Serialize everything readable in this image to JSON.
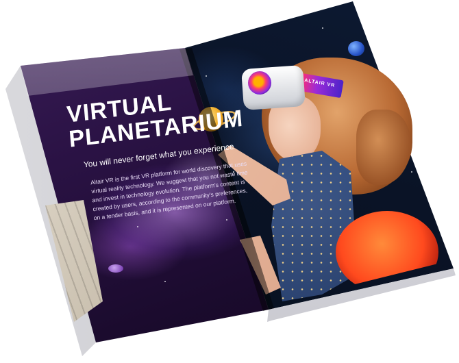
{
  "magazine": {
    "left_page": {
      "title_line1": "VIRTUAL",
      "title_line2": "PLANETARIUM",
      "subtitle": "You will never forget what you experience",
      "body": "Altair VR is the first VR platform for world discovery that uses virtual reality technology. We suggest that you not waste time and invest in technology evolution. The platform's content is created by users, according to the community's preferences, on a tender basis, and it is represented on our platform."
    },
    "right_page": {
      "headset_strap_text": "ALTAIR VR"
    }
  },
  "colors": {
    "left_page_purple": "#2a1244",
    "right_page_space": "#0a1326",
    "title_white": "#ffffff",
    "accent_orange": "#ff4a1e"
  }
}
